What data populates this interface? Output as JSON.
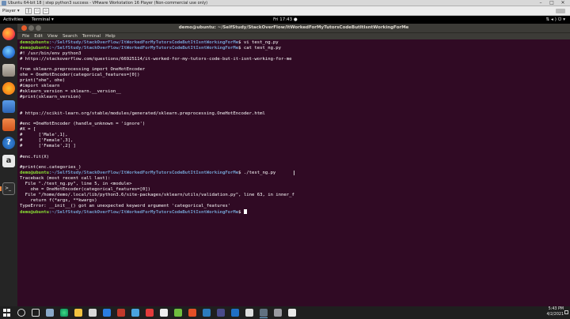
{
  "vm_window": {
    "title": "Ubuntu 64-bit 18 | step python3 success - VMware Workstation 16 Player (Non-commercial use only)",
    "player_menu": "Player ▾",
    "controls": [
      "minimize",
      "maximize",
      "close"
    ]
  },
  "ubuntu_topbar": {
    "activities": "Activities",
    "app_menu": "Terminal ▾",
    "clock": "Fri 17:43 ●",
    "tray_icons": [
      "network-icon",
      "volume-icon",
      "power-icon"
    ]
  },
  "dock": {
    "items": [
      "firefox",
      "thunderbird",
      "files",
      "rhythmbox",
      "libreoffice-writer",
      "ubuntu-software",
      "help",
      "amazon",
      "terminal"
    ],
    "help_glyph": "?",
    "amazon_glyph": "a",
    "terminal_glyph": ">_"
  },
  "terminal": {
    "title": "demo@ubuntu: ~/SelfStudy/StackOverFlow/ItWorkedForMyTutorsCodeButItIsntWorkingForMe",
    "menu": [
      "File",
      "Edit",
      "View",
      "Search",
      "Terminal",
      "Help"
    ],
    "prompt_user": "demo@ubuntu",
    "prompt_path": ":~/SelfStudy/StackOverFlow/ItWorkedForMyTutorsCodeButItIsntWorkingForMe",
    "cmd1": "$ vi test_ng.py",
    "cmd2": "$ cat test_ng.py",
    "cat_output": [
      "#! /usr/bin/env python3",
      "# https://stackoverflow.com/questions/66925114/it-worked-for-my-tutors-code-but-it-isnt-working-for-me",
      "",
      "from sklearn.preprocessing import OneHotEncoder",
      "ohe = OneHotEncoder(categorical_features=[0])",
      "print(\"ohe\", ohe)",
      "#import sklearn",
      "#sklearn_version = sklearn.__version__",
      "#print(sklearn_version)",
      "",
      "",
      "# https://scikit-learn.org/stable/modules/generated/sklearn.preprocessing.OneHotEncoder.html",
      "",
      "#enc =OneHotEncoder (handle_unknown = 'ignore')",
      "#X = [",
      "#      ['Male',1],",
      "#      ['Female',3],",
      "#      ['Female',2] ]",
      "",
      "#enc.fit(X)",
      "",
      "#print(enc.categories_)"
    ],
    "cmd3": "$ ./test_ng.py",
    "run_output": [
      "Traceback (most recent call last):",
      "  File \"./test_ng.py\", line 5, in <module>",
      "    ohe = OneHotEncoder(categorical_features=[0])",
      "  File \"/home/demo/.local/lib/python3.6/site-packages/sklearn/utils/validation.py\", line 63, in inner_f",
      "    return f(*args, **kwargs)",
      "TypeError: __init__() got an unexpected keyword argument 'categorical_features'"
    ],
    "cmd4": "$ "
  },
  "taskbar": {
    "time": "5:43 PM",
    "date": "4/2/2021",
    "accent": "#76b9ed"
  }
}
